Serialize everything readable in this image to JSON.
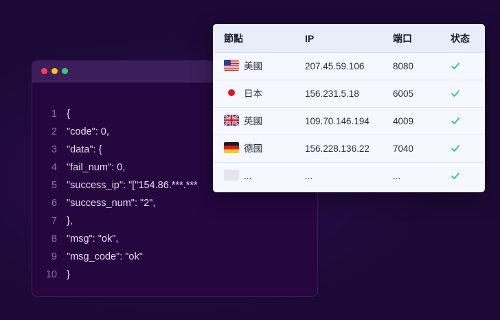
{
  "code_window": {
    "lines": [
      {
        "n": "1",
        "text": "{"
      },
      {
        "n": "2",
        "text": "\"code\": 0,"
      },
      {
        "n": "3",
        "text": "\"data\": {"
      },
      {
        "n": "4",
        "text": "\"fail_num\": 0,"
      },
      {
        "n": "5",
        "text": "\"success_ip\": \"[\"154.86.***.***"
      },
      {
        "n": "6",
        "text": "\"success_num\": \"2\","
      },
      {
        "n": "7",
        "text": "},"
      },
      {
        "n": "8",
        "text": "\"msg\": \"ok\","
      },
      {
        "n": "9",
        "text": "\"msg_code\": \"ok\""
      },
      {
        "n": "10",
        "text": "}"
      }
    ]
  },
  "node_table": {
    "headers": {
      "node": "節點",
      "ip": "IP",
      "port": "端口",
      "status": "状态"
    },
    "rows": [
      {
        "flag": "us-flag-icon",
        "country": "美國",
        "ip": "207.45.59.106",
        "port": "8080",
        "status": "ok"
      },
      {
        "flag": "jp-flag-icon",
        "country": "日本",
        "ip": "156.231.5.18",
        "port": "6005",
        "status": "ok"
      },
      {
        "flag": "uk-flag-icon",
        "country": "英國",
        "ip": "109.70.146.194",
        "port": "4009",
        "status": "ok"
      },
      {
        "flag": "de-flag-icon",
        "country": "德國",
        "ip": "156.228.136.22",
        "port": "7040",
        "status": "ok"
      },
      {
        "flag": "placeholder-flag-icon",
        "country": "...",
        "ip": "...",
        "port": "...",
        "status": "ok"
      }
    ]
  },
  "colors": {
    "check": "#22c98a",
    "background": "#1c0936",
    "code_text": "#e6dcf2"
  }
}
